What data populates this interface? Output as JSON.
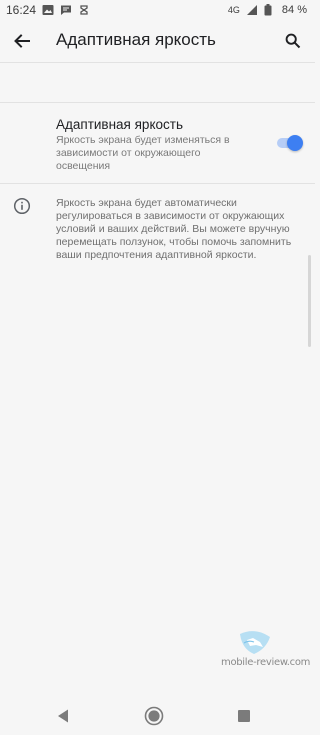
{
  "status_bar": {
    "time": "16:24",
    "network": "4G",
    "battery": "84 %",
    "icons": [
      "image-icon",
      "message-icon",
      "sync-icon",
      "signal-icon",
      "battery-icon"
    ]
  },
  "toolbar": {
    "title": "Адаптивная яркость",
    "back_icon": "arrow-back-icon",
    "search_icon": "search-icon"
  },
  "setting": {
    "title": "Адаптивная яркость",
    "summary": "Яркость экрана будет изменяться в зависимости от окружающего освещения",
    "enabled": true
  },
  "footer": {
    "icon": "info-icon",
    "text": "Яркость экрана будет автоматически регулироваться в зависимости от окружающих условий и ваших действий. Вы можете вручную перемещать ползунок, чтобы помочь запомнить ваши предпочтения адаптивной яркости."
  },
  "watermark": {
    "text": "mobile-review.com"
  },
  "navigation": {
    "back": "nav-back-icon",
    "home": "nav-home-icon",
    "recents": "nav-recents-icon"
  },
  "colors": {
    "accent": "#3d7ff2",
    "accent_track": "#b6cdf6",
    "background": "#f6f6f6"
  }
}
